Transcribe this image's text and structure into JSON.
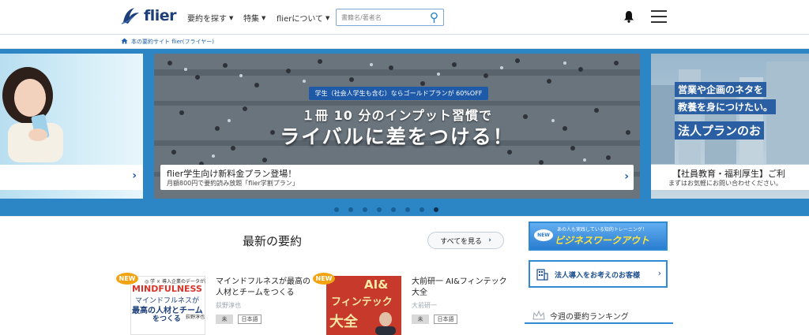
{
  "header": {
    "logo_text": "flier",
    "nav": [
      {
        "label": "要約を探す"
      },
      {
        "label": "特集"
      },
      {
        "label": "flierについて"
      }
    ],
    "search_placeholder": "書籍名/著者名"
  },
  "breadcrumb": {
    "text": "本の要約サイト flier(フライヤー)"
  },
  "carousel": {
    "main": {
      "badge": "学生（社会人学生も含む）ならゴールドプランが 60%OFF",
      "headline1": "１冊 10 分のインプット習慣で",
      "headline2": "ライバルに差をつける！",
      "caption_title": "flier学生向け新料金プラン登場！",
      "caption_sub": "月額800円で要約読み放題「flier学割プラン」"
    },
    "right": {
      "line1": "営業や企画のネタを",
      "line2": "教養を身につけたい。",
      "line3": "法人プランのお",
      "caption_title": "【社員教育・福利厚生】ご利",
      "caption_sub": "まずはお気軽にお問い合わせください。"
    },
    "dots_count": 8,
    "active_dot": 7
  },
  "latest": {
    "title": "最新の要約",
    "see_all": "すべてを見る"
  },
  "books": [
    {
      "new_label": "NEW",
      "cover_lines": [
        "◎ 学 × 導入企業のデータが証明！",
        "MINDFULNESS",
        "マインドフルネスが",
        "最高の人材とチーム",
        "をつくる",
        "荻野淳也"
      ],
      "title": "マインドフルネスが最高の人材とチームをつくる",
      "author": "荻野淳也",
      "tags": [
        "未",
        "日本語"
      ]
    },
    {
      "new_label": "NEW",
      "cover_lines": [
        "AI&",
        "フィンテック",
        "大全"
      ],
      "title": "大前研一 AI&フィンテック大全",
      "author": "大前研一",
      "tags": [
        "未",
        "日本語"
      ]
    }
  ],
  "side": {
    "workout_small": "あの人も実践している知的トレーニング！",
    "workout_new": "NEW",
    "workout_big": "ビジネスワークアウト",
    "corporate": "法人導入をお考えのお客様",
    "ranking": "今週の要約ランキング"
  },
  "colors": {
    "brand": "#1d3f7a",
    "accent": "#2c86c5",
    "new_badge": "#f3a30f"
  }
}
